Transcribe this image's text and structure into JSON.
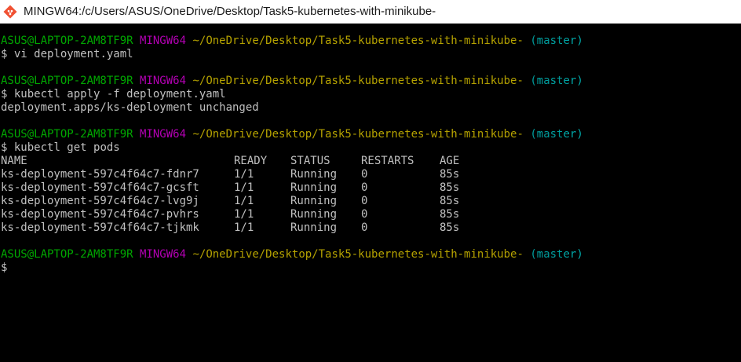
{
  "window": {
    "title": "MINGW64:/c/Users/ASUS/OneDrive/Desktop/Task5-kubernetes-with-minikube-",
    "icon": "git-bash-icon"
  },
  "prompt": {
    "user_host": "ASUS@LAPTOP-2AM8TF9R",
    "system": "MINGW64",
    "path": "~/OneDrive/Desktop/Task5-kubernetes-with-minikube-",
    "branch": "(master)",
    "symbol": "$"
  },
  "blocks": [
    {
      "command": "vi deployment.yaml",
      "output": []
    },
    {
      "command": "kubectl apply -f deployment.yaml",
      "output": [
        "deployment.apps/ks-deployment unchanged"
      ]
    },
    {
      "command": "kubectl get pods",
      "output": []
    }
  ],
  "pods_table": {
    "headers": [
      "NAME",
      "READY",
      "STATUS",
      "RESTARTS",
      "AGE"
    ],
    "rows": [
      [
        "ks-deployment-597c4f64c7-fdnr7",
        "1/1",
        "Running",
        "0",
        "85s"
      ],
      [
        "ks-deployment-597c4f64c7-gcsft",
        "1/1",
        "Running",
        "0",
        "85s"
      ],
      [
        "ks-deployment-597c4f64c7-lvg9j",
        "1/1",
        "Running",
        "0",
        "85s"
      ],
      [
        "ks-deployment-597c4f64c7-pvhrs",
        "1/1",
        "Running",
        "0",
        "85s"
      ],
      [
        "ks-deployment-597c4f64c7-tjkmk",
        "1/1",
        "Running",
        "0",
        "85s"
      ]
    ]
  },
  "colors": {
    "background": "#000000",
    "text": "#c0c0c0",
    "user_host": "#00a800",
    "system": "#b300b3",
    "path": "#b5a200",
    "branch": "#00a0a0"
  }
}
